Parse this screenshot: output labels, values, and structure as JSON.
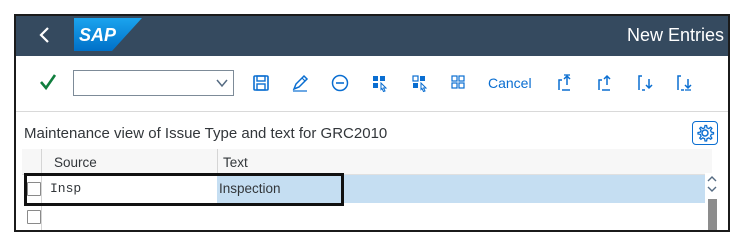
{
  "shell": {
    "back_icon": "chevron-left-icon",
    "logo_text": "SAP",
    "brand_color": "#1a8fd8",
    "header_color": "#354a5f",
    "title": "New Entries"
  },
  "toolbar": {
    "enter_icon": "check-icon",
    "dropdown_value": "",
    "dropdown_icon": "chevron-down-icon",
    "icons": [
      "save-icon",
      "edit-icon",
      "minus-circle-icon",
      "select-all-icon",
      "select-block-icon",
      "deselect-all-icon"
    ],
    "cancel_label": "Cancel",
    "nav_icons": [
      "first-page-icon",
      "previous-page-icon",
      "next-page-icon",
      "last-page-icon"
    ]
  },
  "maintenance": {
    "title": "Maintenance view of Issue Type and text for GRC2010",
    "settings_icon": "gear-icon"
  },
  "table": {
    "columns": [
      "Source",
      "Text"
    ],
    "rows": [
      {
        "source": "Insp",
        "text": "Inspection"
      },
      {
        "source": "",
        "text": ""
      }
    ],
    "selection_color": "#c5def2"
  }
}
